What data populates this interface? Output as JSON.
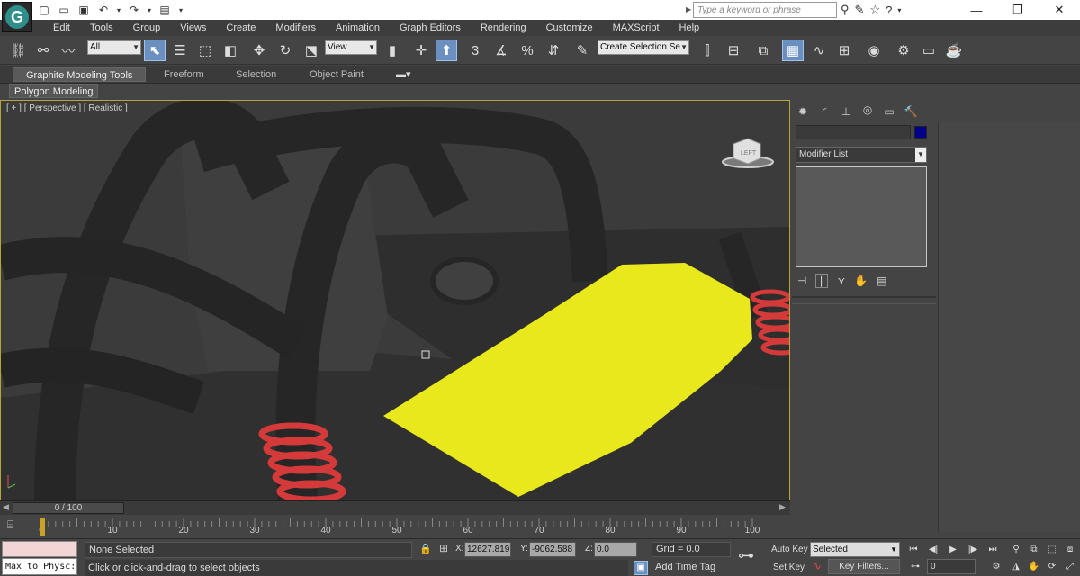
{
  "app": {
    "logo_letter": "G"
  },
  "search": {
    "placeholder": "Type a keyword or phrase"
  },
  "menubar": {
    "items": [
      "Edit",
      "Tools",
      "Group",
      "Views",
      "Create",
      "Modifiers",
      "Animation",
      "Graph Editors",
      "Rendering",
      "Customize",
      "MAXScript",
      "Help"
    ]
  },
  "toolbar": {
    "selection_filter": "All",
    "reference_coord": "View",
    "named_selection": "Create Selection Se",
    "snap_labels": {
      "snap3": "3",
      "percent": "%"
    }
  },
  "ribbon": {
    "tabs": [
      "Graphite Modeling Tools",
      "Freeform",
      "Selection",
      "Object Paint"
    ],
    "active_tab": "Graphite Modeling Tools",
    "panel": "Polygon Modeling"
  },
  "viewport": {
    "label": "[ + ] [ Perspective ] [ Realistic ]",
    "viewcube_text": "LEFT",
    "colors": {
      "border": "#b9a437",
      "highlight": "#e8e81c",
      "spring": "#d43a3a"
    }
  },
  "command_panel": {
    "modifier_list": "Modifier List",
    "object_color": "#00008b"
  },
  "timeline": {
    "slider": "0 / 100",
    "ticks": [
      "0",
      "10",
      "20",
      "30",
      "40",
      "50",
      "60",
      "70",
      "80",
      "90",
      "100"
    ]
  },
  "status": {
    "maxscript": "Max to Physc:",
    "selection": "None Selected",
    "prompt": "Click or click-and-drag to select objects",
    "x_label": "X:",
    "x_value": "12627.819",
    "y_label": "Y:",
    "y_value": "-9062.588",
    "z_label": "Z:",
    "z_value": "0.0",
    "grid": "Grid = 0.0",
    "add_time_tag": "Add Time Tag",
    "auto_key": "Auto Key",
    "set_key": "Set Key",
    "key_mode": "Selected",
    "key_filters": "Key Filters...",
    "current_frame": "0"
  }
}
